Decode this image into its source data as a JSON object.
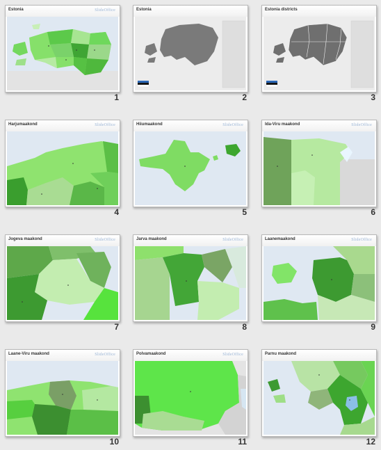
{
  "slides": [
    {
      "number": "1",
      "title": "Estonia"
    },
    {
      "number": "2",
      "title": "Estonia"
    },
    {
      "number": "3",
      "title": "Estonia districts"
    },
    {
      "number": "4",
      "title": "Harjumaakond"
    },
    {
      "number": "5",
      "title": "Hiiumaakond"
    },
    {
      "number": "6",
      "title": "Ida-Viru maakond"
    },
    {
      "number": "7",
      "title": "Jogeva maakond"
    },
    {
      "number": "8",
      "title": "Jarva maakond"
    },
    {
      "number": "9",
      "title": "Laanemaakond"
    },
    {
      "number": "10",
      "title": "Laane-Viru maakond"
    },
    {
      "number": "11",
      "title": "Polvamaakond"
    },
    {
      "number": "12",
      "title": "Parnu maakond"
    }
  ],
  "logo": "SlideOffice",
  "colors": {
    "sea": "#dbe5f0",
    "land_gray": "#d8d8d8",
    "green_light": "#a8e68a",
    "green": "#6ee04f",
    "green_dark": "#3aa02a",
    "map_gray": "#777777"
  }
}
